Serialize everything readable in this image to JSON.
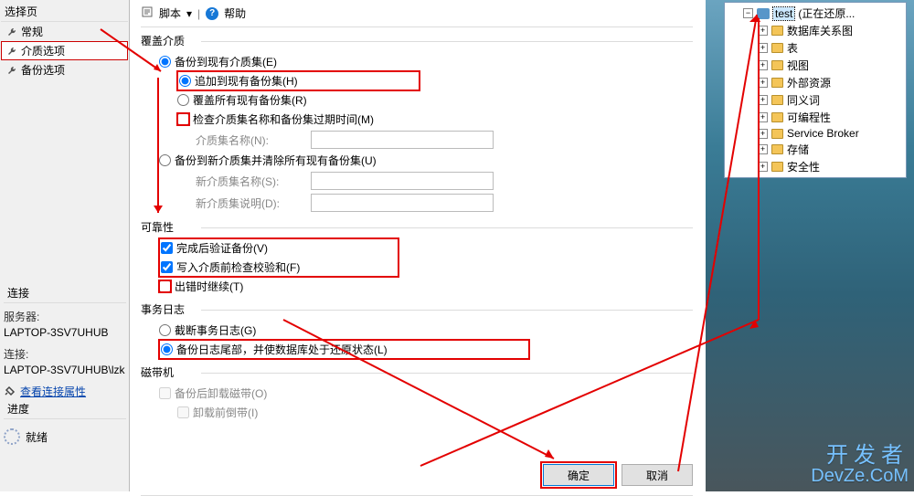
{
  "sidebar": {
    "header": "选择页",
    "items": [
      {
        "label": "常规"
      },
      {
        "label": "介质选项"
      },
      {
        "label": "备份选项"
      }
    ]
  },
  "connection": {
    "header": "连接",
    "server_label": "服务器:",
    "server_value": "LAPTOP-3SV7UHUB",
    "conn_label": "连接:",
    "conn_value": "LAPTOP-3SV7UHUB\\lzk",
    "view_props": "查看连接属性"
  },
  "progress": {
    "header": "进度",
    "status": "就绪"
  },
  "toolbar": {
    "script": "脚本",
    "help": "帮助"
  },
  "groups": {
    "override_media": "覆盖介质",
    "reliability": "可靠性",
    "txn_log": "事务日志",
    "tape": "磁带机"
  },
  "override": {
    "backup_to_existing": "备份到现有介质集(E)",
    "append_existing": "追加到现有备份集(H)",
    "overwrite_all": "覆盖所有现有备份集(R)",
    "check_name": "检查介质集名称和备份集过期时间(M)",
    "media_name_label": "介质集名称(N):",
    "media_name_value": "",
    "backup_new_erase": "备份到新介质集并清除所有现有备份集(U)",
    "new_media_name_label": "新介质集名称(S):",
    "new_media_name_value": "",
    "new_media_desc_label": "新介质集说明(D):",
    "new_media_desc_value": ""
  },
  "reliability": {
    "verify": "完成后验证备份(V)",
    "checksum": "写入介质前检查校验和(F)",
    "continue_error": "出错时继续(T)"
  },
  "txnlog": {
    "truncate": "截断事务日志(G)",
    "tail_restore": "备份日志尾部，并使数据库处于还原状态(L)"
  },
  "tape": {
    "unload_after": "备份后卸载磁带(O)",
    "rewind_before": "卸载前倒带(I)"
  },
  "buttons": {
    "ok": "确定",
    "cancel": "取消"
  },
  "tree": {
    "root": "test",
    "root_status": "(正在还原...",
    "children": [
      "数据库关系图",
      "表",
      "视图",
      "外部资源",
      "同义词",
      "可编程性",
      "Service Broker",
      "存储",
      "安全性"
    ]
  },
  "watermark": {
    "line1": "开发者",
    "line2": "DevZe.CoM"
  }
}
